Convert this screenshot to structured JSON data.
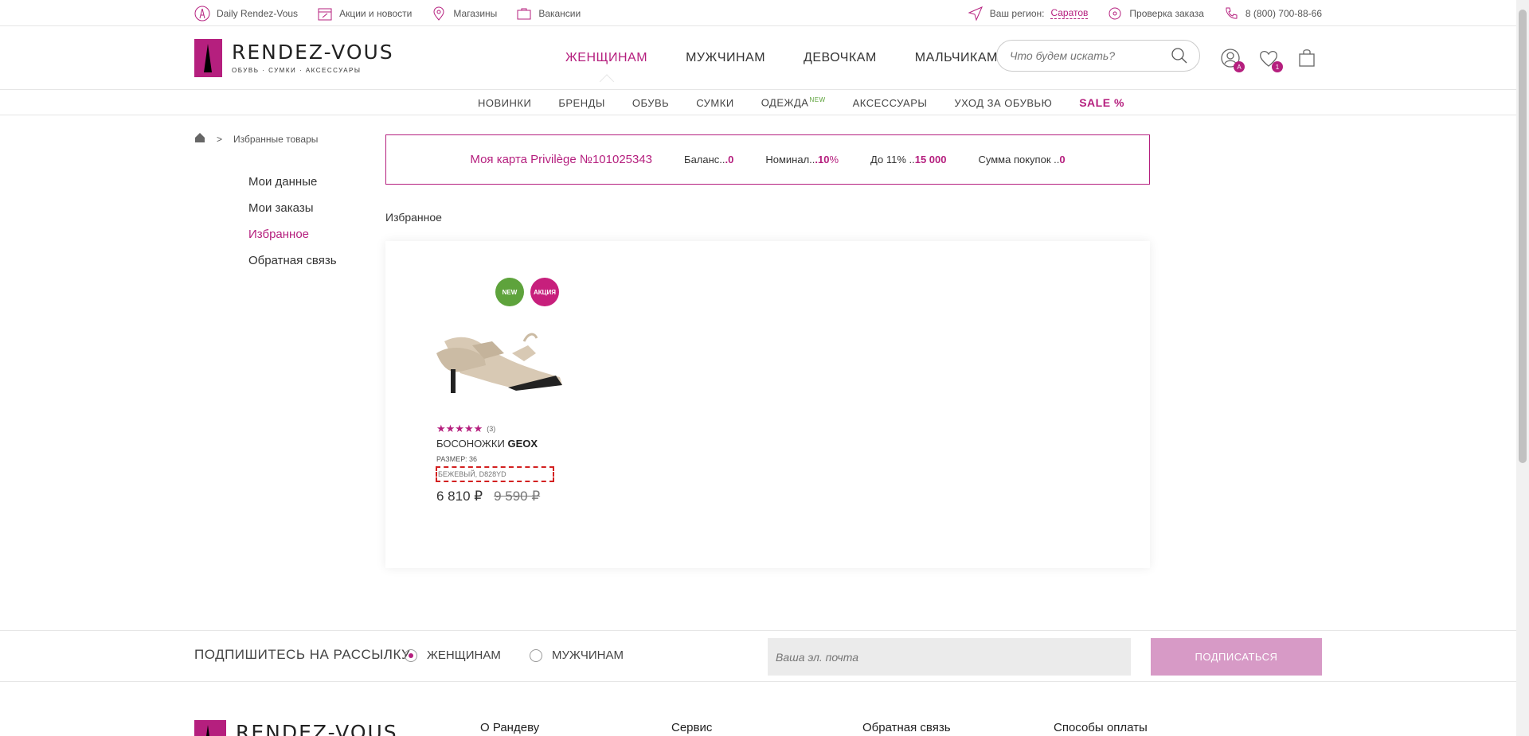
{
  "topbar": {
    "daily": "Daily Rendez-Vous",
    "promo": "Акции и новости",
    "stores": "Магазины",
    "jobs": "Вакансии",
    "region_label": "Ваш регион:",
    "region_city": "Саратов",
    "order_check": "Проверка заказа",
    "phone": "8 (800) 700-88-66"
  },
  "brand": {
    "name": "RENDEZ-VOUS",
    "tagline": "ОБУВЬ · СУМКИ · АКСЕССУАРЫ",
    "accent": "#b51f7e"
  },
  "mainnav": [
    "ЖЕНЩИНАМ",
    "МУЖЧИНАМ",
    "ДЕВОЧКАМ",
    "МАЛЬЧИКАМ"
  ],
  "search": {
    "placeholder": "Что будем искать?"
  },
  "header_icons": {
    "account_badge": "A",
    "wishlist_badge": "1"
  },
  "subnav": {
    "items": [
      "НОВИНКИ",
      "БРЕНДЫ",
      "ОБУВЬ",
      "СУМКИ",
      "ОДЕЖДА",
      "АКСЕССУАРЫ",
      "УХОД ЗА ОБУВЬЮ"
    ],
    "clothing_tag": "NEW",
    "sale": "SALE %"
  },
  "breadcrumb": {
    "sep": ">",
    "current": "Избранные товары"
  },
  "sidemenu": [
    "Мои данные",
    "Мои заказы",
    "Избранное",
    "Обратная связь"
  ],
  "privilege": {
    "card": "Моя карта Privilège №101025343",
    "balance_label": "Баланс..",
    "balance_value": ".0",
    "nominal_label": "Номинал..",
    "nominal_value": ".10",
    "nominal_unit": "%",
    "upto_label": "До 11% ..",
    "upto_value": "15 000",
    "sum_label": "Сумма покупок ..",
    "sum_value": "0"
  },
  "favorites_title": "Избранное",
  "product": {
    "badge_new": "NEW",
    "badge_sale": "АКЦИЯ",
    "rating": 5,
    "stars": "★★★★★",
    "reviews": "(3)",
    "type": "БОСОНОЖКИ",
    "brand": "GEOX",
    "size": "РАЗМЕР: 36",
    "color": "БЕЖЕВЫЙ, D828YD",
    "price": "6 810 ₽",
    "old_price": "9 590 ₽"
  },
  "subscribe": {
    "label": "ПОДПИШИТЕСЬ НА РАССЫЛКУ",
    "opt_women": "ЖЕНЩИНАМ",
    "opt_men": "МУЖЧИНАМ",
    "email_placeholder": "Ваша эл. почта",
    "button": "ПОДПИСАТЬСЯ"
  },
  "footer": {
    "columns": [
      "О Рандеву",
      "Сервис",
      "Обратная связь",
      "Способы оплаты"
    ]
  }
}
